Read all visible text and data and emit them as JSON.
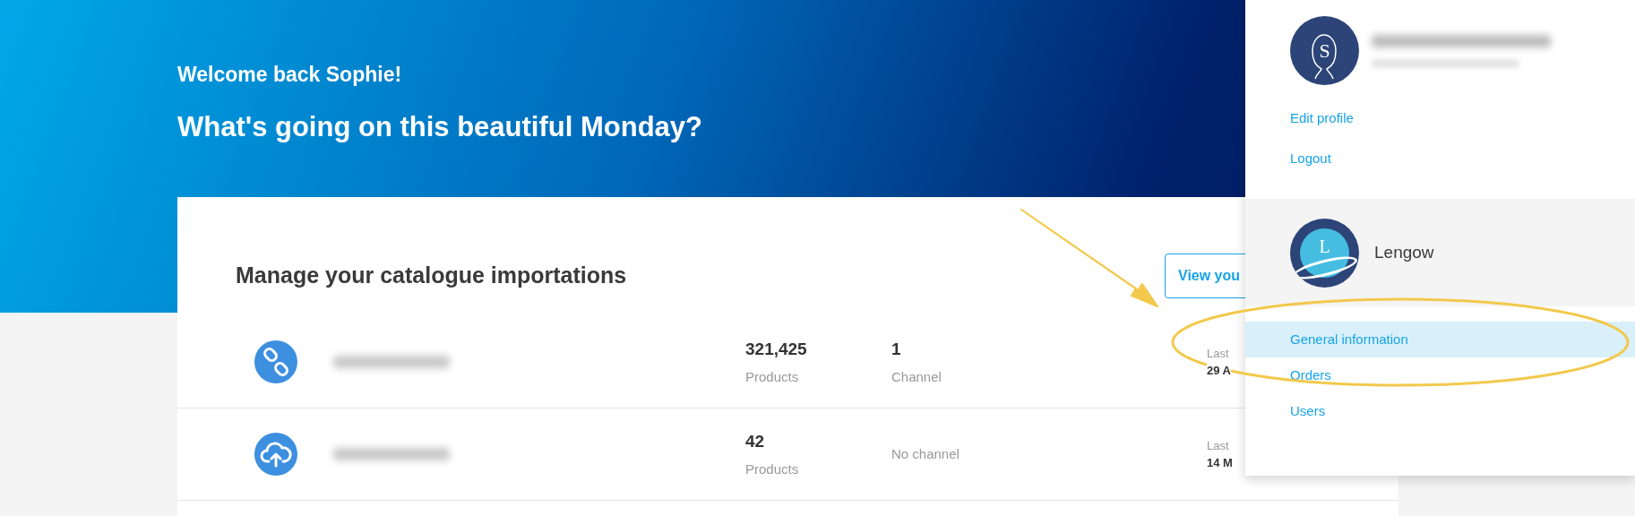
{
  "header": {
    "greeting": "Welcome back Sophie!",
    "headline": "What's going on this beautiful Monday?"
  },
  "catalogue": {
    "title": "Manage your catalogue importations",
    "view_button": "View you",
    "rows": [
      {
        "kind": "link",
        "products_count": "321,425",
        "products_label": "Products",
        "channels_count": "1",
        "channels_label": "Channel",
        "last_label": "Last",
        "last_date": "29 A"
      },
      {
        "kind": "upload",
        "products_count": "42",
        "products_label": "Products",
        "channels_label": "No channel",
        "last_label": "Last",
        "last_date": "14 M"
      }
    ]
  },
  "account_menu": {
    "avatar_initial": "S",
    "profile_links": [
      {
        "label": "Edit profile"
      },
      {
        "label": "Logout"
      }
    ],
    "account_initial": "L",
    "account_name": "Lengow",
    "items": [
      {
        "label": "General information",
        "selected": true
      },
      {
        "label": "Orders",
        "selected": false
      },
      {
        "label": "Users",
        "selected": false
      }
    ]
  }
}
